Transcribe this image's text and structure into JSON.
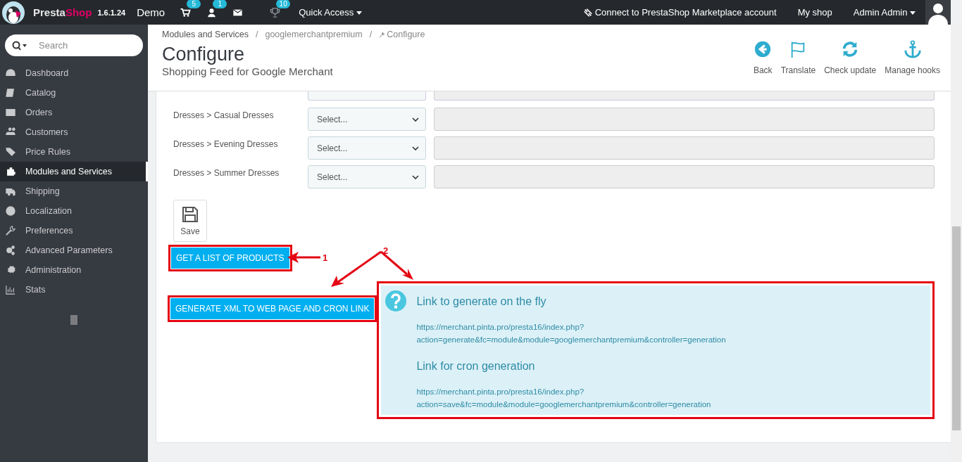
{
  "topbar": {
    "brand_parts": [
      "Presta",
      "Shop"
    ],
    "version": "1.6.1.24",
    "shop_name": "Demo",
    "notifications": [
      {
        "count": "5"
      },
      {
        "count": "1"
      }
    ],
    "achievements": {
      "count": "10"
    },
    "quick_access": "Quick Access",
    "marketplace": "Connect to PrestaShop Marketplace account",
    "my_shop": "My shop",
    "user": "Admin Admin"
  },
  "sidebar": {
    "search": {
      "placeholder": "Search"
    },
    "items": [
      {
        "label": "Dashboard",
        "selected": false
      },
      {
        "label": "Catalog",
        "selected": false
      },
      {
        "label": "Orders",
        "selected": false
      },
      {
        "label": "Customers",
        "selected": false
      },
      {
        "label": "Price Rules",
        "selected": false
      },
      {
        "label": "Modules and Services",
        "selected": true
      },
      {
        "label": "Shipping",
        "selected": false
      },
      {
        "label": "Localization",
        "selected": false
      },
      {
        "label": "Preferences",
        "selected": false
      },
      {
        "label": "Advanced Parameters",
        "selected": false
      },
      {
        "label": "Administration",
        "selected": false
      },
      {
        "label": "Stats",
        "selected": false
      }
    ]
  },
  "header": {
    "breadcrumb": [
      "Modules and Services",
      "googlemerchantpremium",
      "Configure"
    ],
    "breadcrumb_separator": "/",
    "title": "Configure",
    "subtitle": "Shopping Feed for Google Merchant",
    "toolbar": [
      "Back",
      "Translate",
      "Check update",
      "Manage hooks"
    ]
  },
  "form": {
    "rows": [
      {
        "category": "Dresses > Casual Dresses",
        "select": "Select..."
      },
      {
        "category": "Dresses > Evening Dresses",
        "select": "Select..."
      },
      {
        "category": "Dresses > Summer Dresses",
        "select": "Select..."
      }
    ],
    "save": "Save",
    "list_button": "GET A LIST OF PRODUCTS",
    "generate_button": "GENERATE XML TO WEB PAGE AND CRON LINK"
  },
  "info": {
    "sections": [
      {
        "heading": "Link to generate on the fly",
        "url_lines": [
          "https://merchant.pinta.pro/presta16/index.php?",
          "action=generate&fc=module&module=googlemerchantpremium&controller=generation"
        ]
      },
      {
        "heading": "Link for cron generation",
        "url_lines": [
          "https://merchant.pinta.pro/presta16/index.php?",
          "action=save&fc=module&module=googlemerchantpremium&controller=generation"
        ]
      }
    ]
  },
  "annotations": [
    "1",
    "2"
  ]
}
